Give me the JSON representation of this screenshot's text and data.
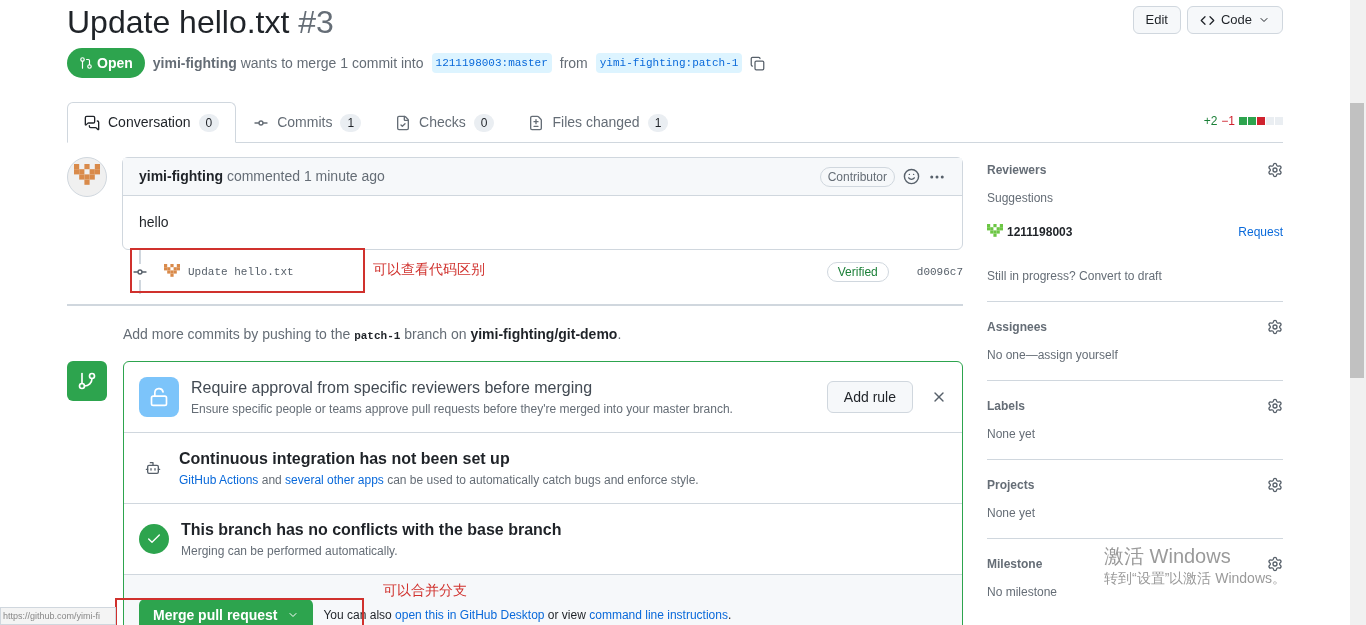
{
  "header": {
    "title": "Update hello.txt",
    "number": "#3",
    "actions": [
      {
        "kind": "edit",
        "label": "Edit"
      },
      {
        "kind": "code",
        "label": "Code"
      }
    ]
  },
  "meta": {
    "state": "Open",
    "author": "yimi-fighting",
    "text": "wants to merge 1 commit into",
    "base": "1211198003:master",
    "from": "from",
    "head": "yimi-fighting:patch-1"
  },
  "tabs": [
    {
      "kind": "conversation",
      "label": "Conversation",
      "count": "0",
      "selected": true
    },
    {
      "kind": "commits",
      "label": "Commits",
      "count": "1",
      "selected": false
    },
    {
      "kind": "checks",
      "label": "Checks",
      "count": "0",
      "selected": false
    },
    {
      "kind": "files",
      "label": "Files changed",
      "count": "1",
      "selected": false
    }
  ],
  "diffstat": {
    "added": "+2",
    "removed": "−1",
    "blocks": [
      {
        "kind": "added"
      },
      {
        "kind": "added"
      },
      {
        "kind": "removed"
      },
      {
        "kind": "neutral"
      },
      {
        "kind": "neutral"
      }
    ]
  },
  "comment": {
    "author": "yimi-fighting",
    "action": "commented 1 minute ago",
    "badge": "Contributor",
    "body": "hello"
  },
  "commit": {
    "message": "Update hello.txt",
    "badge": "Verified",
    "sha": "d0096c7"
  },
  "push_hint": {
    "before": "Add more commits by pushing to the",
    "branch": "patch-1",
    "middle": "branch on",
    "repo": "yimi-fighting/git-demo",
    "after": "."
  },
  "merge_box": {
    "rows": [
      {
        "kind": "approval",
        "title": "Require approval from specific reviewers before merging",
        "text": "Ensure specific people or teams approve pull requests before they're merged into your master branch.",
        "button": "Add rule"
      },
      {
        "kind": "ci",
        "title": "Continuous integration has not been set up",
        "link1": "GitHub Actions",
        "and": "and",
        "link2": "several other apps",
        "text": "can be used to automatically catch bugs and enforce style."
      },
      {
        "kind": "ok",
        "title": "This branch has no conflicts with the base branch",
        "text": "Merging can be performed automatically."
      }
    ],
    "button": "Merge pull request",
    "alt_before": "You can also",
    "alt_link1": "open this in GitHub Desktop",
    "alt_middle": "or view",
    "alt_link2": "command line instructions",
    "alt_after": "."
  },
  "sidebar": [
    {
      "title": "Reviewers",
      "lines": [
        {
          "kind": "label",
          "text": "Suggestions"
        },
        {
          "kind": "reviewer",
          "text": "1211198003",
          "action": "Request"
        },
        {
          "kind": "note",
          "text": "Still in progress? Convert to draft"
        }
      ]
    },
    {
      "title": "Assignees",
      "lines": [
        {
          "kind": "note",
          "text": "No one—assign yourself"
        }
      ]
    },
    {
      "title": "Labels",
      "lines": [
        {
          "kind": "note",
          "text": "None yet"
        }
      ]
    },
    {
      "title": "Projects",
      "lines": [
        {
          "kind": "note",
          "text": "None yet"
        }
      ]
    },
    {
      "title": "Milestone",
      "lines": [
        {
          "kind": "note",
          "text": "No milestone"
        }
      ]
    }
  ],
  "annotations": [
    "可以查看代码区别",
    "可以合并分支"
  ],
  "activation": {
    "title": "激活 Windows",
    "text": "转到“设置”以激活 Windows。"
  },
  "status_url": "https://github.com/yimi-fi"
}
